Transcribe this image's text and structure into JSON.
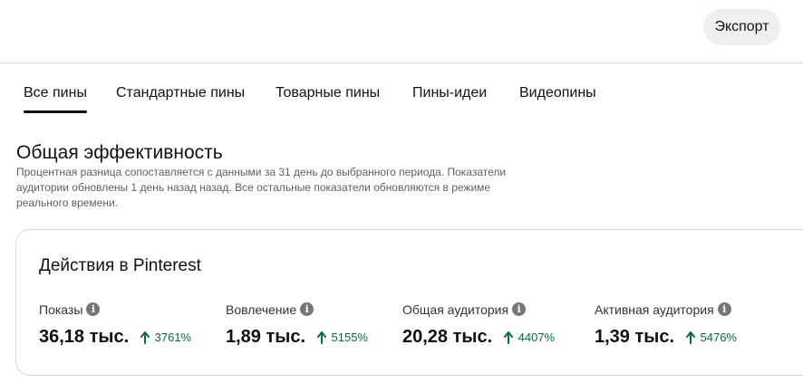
{
  "header": {
    "export_label": "Экспорт"
  },
  "tabs": [
    {
      "label": "Все пины",
      "active": true
    },
    {
      "label": "Стандартные пины",
      "active": false
    },
    {
      "label": "Товарные пины",
      "active": false
    },
    {
      "label": "Пины-идеи",
      "active": false
    },
    {
      "label": "Видеопины",
      "active": false
    }
  ],
  "overview": {
    "title": "Общая эффективность",
    "description": "Процентная разница сопоставляется с данными за 31 день до выбранного периода. Показатели аудитории обновлены 1 день назад назад. Все остальные показатели обновляются в режиме реального времени."
  },
  "card": {
    "title": "Действия в Pinterest",
    "metrics": [
      {
        "label": "Показы",
        "value": "36,18 тыс.",
        "change": "3761%",
        "trend": "up"
      },
      {
        "label": "Вовлечение",
        "value": "1,89 тыс.",
        "change": "5155%",
        "trend": "up"
      },
      {
        "label": "Общая аудитория",
        "value": "20,28 тыс.",
        "change": "4407%",
        "trend": "up"
      },
      {
        "label": "Активная аудитория",
        "value": "1,39 тыс.",
        "change": "5476%",
        "trend": "up"
      }
    ]
  },
  "colors": {
    "trend_up": "#0a6a3e",
    "text": "#111111",
    "muted": "#5f5f5f",
    "button_bg": "#efefef"
  }
}
